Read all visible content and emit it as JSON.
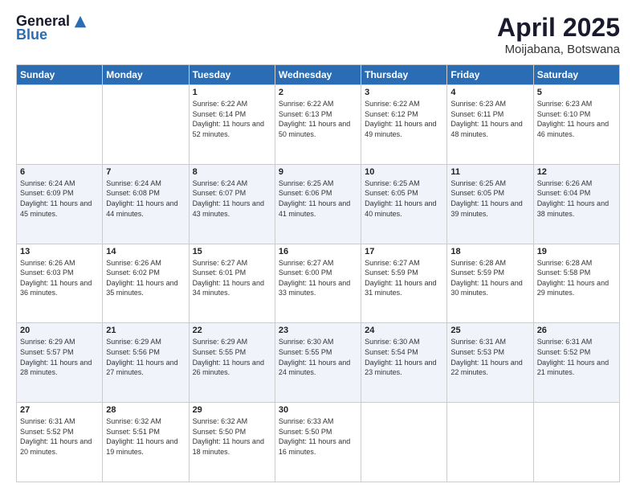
{
  "header": {
    "logo_general": "General",
    "logo_blue": "Blue",
    "title": "April 2025",
    "location": "Moijabana, Botswana"
  },
  "days_of_week": [
    "Sunday",
    "Monday",
    "Tuesday",
    "Wednesday",
    "Thursday",
    "Friday",
    "Saturday"
  ],
  "weeks": [
    [
      {
        "day": "",
        "info": ""
      },
      {
        "day": "",
        "info": ""
      },
      {
        "day": "1",
        "info": "Sunrise: 6:22 AM\nSunset: 6:14 PM\nDaylight: 11 hours and 52 minutes."
      },
      {
        "day": "2",
        "info": "Sunrise: 6:22 AM\nSunset: 6:13 PM\nDaylight: 11 hours and 50 minutes."
      },
      {
        "day": "3",
        "info": "Sunrise: 6:22 AM\nSunset: 6:12 PM\nDaylight: 11 hours and 49 minutes."
      },
      {
        "day": "4",
        "info": "Sunrise: 6:23 AM\nSunset: 6:11 PM\nDaylight: 11 hours and 48 minutes."
      },
      {
        "day": "5",
        "info": "Sunrise: 6:23 AM\nSunset: 6:10 PM\nDaylight: 11 hours and 46 minutes."
      }
    ],
    [
      {
        "day": "6",
        "info": "Sunrise: 6:24 AM\nSunset: 6:09 PM\nDaylight: 11 hours and 45 minutes."
      },
      {
        "day": "7",
        "info": "Sunrise: 6:24 AM\nSunset: 6:08 PM\nDaylight: 11 hours and 44 minutes."
      },
      {
        "day": "8",
        "info": "Sunrise: 6:24 AM\nSunset: 6:07 PM\nDaylight: 11 hours and 43 minutes."
      },
      {
        "day": "9",
        "info": "Sunrise: 6:25 AM\nSunset: 6:06 PM\nDaylight: 11 hours and 41 minutes."
      },
      {
        "day": "10",
        "info": "Sunrise: 6:25 AM\nSunset: 6:05 PM\nDaylight: 11 hours and 40 minutes."
      },
      {
        "day": "11",
        "info": "Sunrise: 6:25 AM\nSunset: 6:05 PM\nDaylight: 11 hours and 39 minutes."
      },
      {
        "day": "12",
        "info": "Sunrise: 6:26 AM\nSunset: 6:04 PM\nDaylight: 11 hours and 38 minutes."
      }
    ],
    [
      {
        "day": "13",
        "info": "Sunrise: 6:26 AM\nSunset: 6:03 PM\nDaylight: 11 hours and 36 minutes."
      },
      {
        "day": "14",
        "info": "Sunrise: 6:26 AM\nSunset: 6:02 PM\nDaylight: 11 hours and 35 minutes."
      },
      {
        "day": "15",
        "info": "Sunrise: 6:27 AM\nSunset: 6:01 PM\nDaylight: 11 hours and 34 minutes."
      },
      {
        "day": "16",
        "info": "Sunrise: 6:27 AM\nSunset: 6:00 PM\nDaylight: 11 hours and 33 minutes."
      },
      {
        "day": "17",
        "info": "Sunrise: 6:27 AM\nSunset: 5:59 PM\nDaylight: 11 hours and 31 minutes."
      },
      {
        "day": "18",
        "info": "Sunrise: 6:28 AM\nSunset: 5:59 PM\nDaylight: 11 hours and 30 minutes."
      },
      {
        "day": "19",
        "info": "Sunrise: 6:28 AM\nSunset: 5:58 PM\nDaylight: 11 hours and 29 minutes."
      }
    ],
    [
      {
        "day": "20",
        "info": "Sunrise: 6:29 AM\nSunset: 5:57 PM\nDaylight: 11 hours and 28 minutes."
      },
      {
        "day": "21",
        "info": "Sunrise: 6:29 AM\nSunset: 5:56 PM\nDaylight: 11 hours and 27 minutes."
      },
      {
        "day": "22",
        "info": "Sunrise: 6:29 AM\nSunset: 5:55 PM\nDaylight: 11 hours and 26 minutes."
      },
      {
        "day": "23",
        "info": "Sunrise: 6:30 AM\nSunset: 5:55 PM\nDaylight: 11 hours and 24 minutes."
      },
      {
        "day": "24",
        "info": "Sunrise: 6:30 AM\nSunset: 5:54 PM\nDaylight: 11 hours and 23 minutes."
      },
      {
        "day": "25",
        "info": "Sunrise: 6:31 AM\nSunset: 5:53 PM\nDaylight: 11 hours and 22 minutes."
      },
      {
        "day": "26",
        "info": "Sunrise: 6:31 AM\nSunset: 5:52 PM\nDaylight: 11 hours and 21 minutes."
      }
    ],
    [
      {
        "day": "27",
        "info": "Sunrise: 6:31 AM\nSunset: 5:52 PM\nDaylight: 11 hours and 20 minutes."
      },
      {
        "day": "28",
        "info": "Sunrise: 6:32 AM\nSunset: 5:51 PM\nDaylight: 11 hours and 19 minutes."
      },
      {
        "day": "29",
        "info": "Sunrise: 6:32 AM\nSunset: 5:50 PM\nDaylight: 11 hours and 18 minutes."
      },
      {
        "day": "30",
        "info": "Sunrise: 6:33 AM\nSunset: 5:50 PM\nDaylight: 11 hours and 16 minutes."
      },
      {
        "day": "",
        "info": ""
      },
      {
        "day": "",
        "info": ""
      },
      {
        "day": "",
        "info": ""
      }
    ]
  ]
}
